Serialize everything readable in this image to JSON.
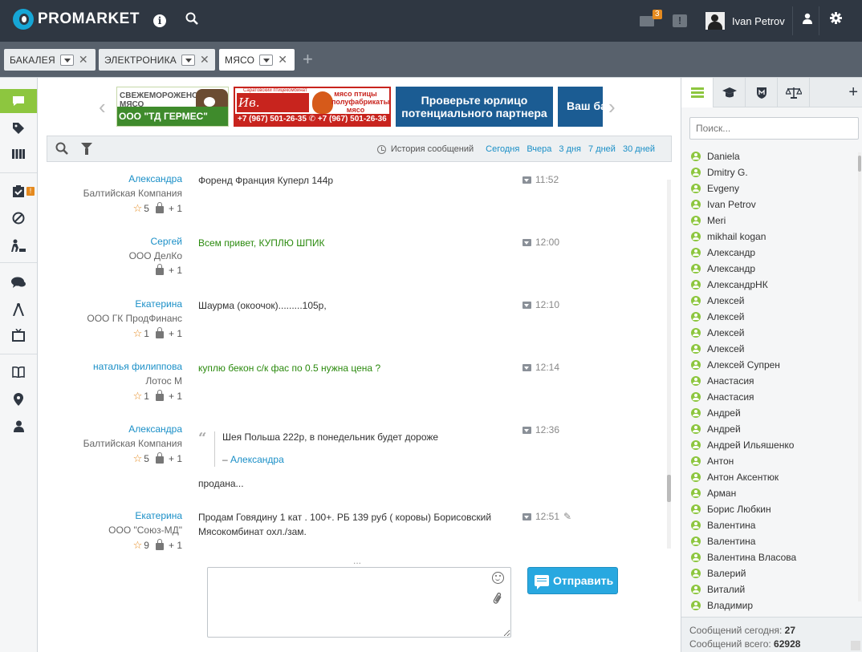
{
  "header": {
    "brand": "PROMARKET",
    "mail_count": "3",
    "user_name": "Ivan Petrov"
  },
  "tabs": [
    {
      "label": "БАКАЛЕЯ"
    },
    {
      "label": "ЭЛЕКТРОНИКА"
    },
    {
      "label": "МЯСО"
    }
  ],
  "banners": {
    "b1_top": "СВЕЖЕМОРОЖЕНОЕ МЯСО",
    "b1_bottom": "ООО \"ТД ГЕРМЕС\"",
    "b2_small": "Саратовский птицекомбинат",
    "b2_logo": "Ив. Курникъ",
    "b2_text": "мясо птицы полуфабрикаты мясо мех.обвалки",
    "b2_phone": "+7 (967) 501-26-35 ✆ +7 (967) 501-26-36",
    "b3_line1": "Проверьте юрлицо",
    "b3_line2": "потенциального партнера",
    "b4": "Ваш ба"
  },
  "filter": {
    "history_label": "История сообщений",
    "links": [
      "Сегодня",
      "Вчера",
      "3 дня",
      "7 дней",
      "30 дней"
    ]
  },
  "messages": [
    {
      "name": "Александра",
      "company": "Балтийская Компания",
      "rating": "5",
      "plus": "+ 1",
      "text": "Форенд Франция Куперл 144р",
      "time": "11:52"
    },
    {
      "name": "Сергей",
      "company": "ООО ДелКо",
      "rating": "",
      "plus": "+ 1",
      "text": "Всем привет, КУПЛЮ ШПИК",
      "time": "12:00"
    },
    {
      "name": "Екатерина",
      "company": "ООО ГК ПродФинанс",
      "rating": "1",
      "plus": "+ 1",
      "text": "Шаурма (окоочок).........105р,",
      "time": "12:10"
    },
    {
      "name": "наталья филиппова",
      "company": "Лотос М",
      "rating": "1",
      "plus": "+ 1",
      "text": "куплю бекон с/к фас по 0.5 нужна цена ?",
      "time": "12:14"
    },
    {
      "name": "Александра",
      "company": "Балтийская Компания",
      "rating": "5",
      "plus": "+ 1",
      "quote_text": "Шея Польша 222р, в понедельник будет дороже",
      "quote_dash": "–",
      "quote_author": "Александра",
      "text": "продана...",
      "time": "12:36"
    },
    {
      "name": "Екатерина",
      "company": "ООО \"Союз-МД\"",
      "rating": "9",
      "plus": "+ 1",
      "text_line1": "Продам Говядину 1 кат . 100+. РБ 139 руб ( коровы) Борисовский",
      "text_line2": "Мясокомбинат охл./зам.",
      "time": "12:51"
    }
  ],
  "composer": {
    "dots": "...",
    "send_label": "Отправить"
  },
  "right": {
    "search_placeholder": "Поиск...",
    "users": [
      "Daniela",
      "Dmitry G.",
      "Evgeny",
      "Ivan Petrov",
      "Meri",
      "mikhail kogan",
      "Александр",
      "Александр",
      "АлександрНК",
      "Алексей",
      "Алексей",
      "Алексей",
      "Алексей",
      "Алексей Супрен",
      "Анастасия",
      "Анастасия",
      "Андрей",
      "Андрей",
      "Андрей Ильяшенко",
      "Антон",
      "Антон Аксентюк",
      "Арман",
      "Борис Любкин",
      "Валентина",
      "Валентина",
      "Валентина Власова",
      "Валерий",
      "Виталий",
      "Владимир"
    ],
    "stats_today_label": "Сообщений сегодня:",
    "stats_today": "27",
    "stats_total_label": "Сообщений всего:",
    "stats_total": "62928"
  },
  "colors": {
    "topbar": "#2f3742",
    "accent_green": "#8dc63f",
    "link_blue": "#1a8fc7",
    "send_blue": "#28a8e0",
    "badge_orange": "#e58a1f"
  }
}
